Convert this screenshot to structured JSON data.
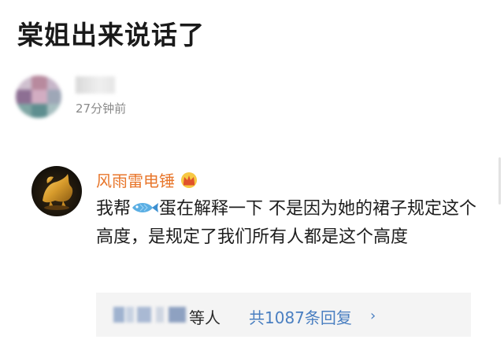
{
  "post": {
    "title": "棠姐出来说话了",
    "time": "27分钟前"
  },
  "comment": {
    "username": "风雨雷电锤",
    "text_before_icon": "我帮",
    "text_after_icon": "蛋在解释一下 不是因为她的裙子规定这个高度，是规定了我们所有人都是这个高度",
    "avatar_icon": "golden-dragon-statue-avatar",
    "badge_icon": "crown-icon",
    "inline_icon": "fish-icon"
  },
  "replies": {
    "tail_text": "等人",
    "count_text": "共1087条回复",
    "chevron": "›"
  },
  "colors": {
    "username": "#e8762b",
    "link": "#4a7fc1",
    "muted": "#8a8a8a"
  }
}
